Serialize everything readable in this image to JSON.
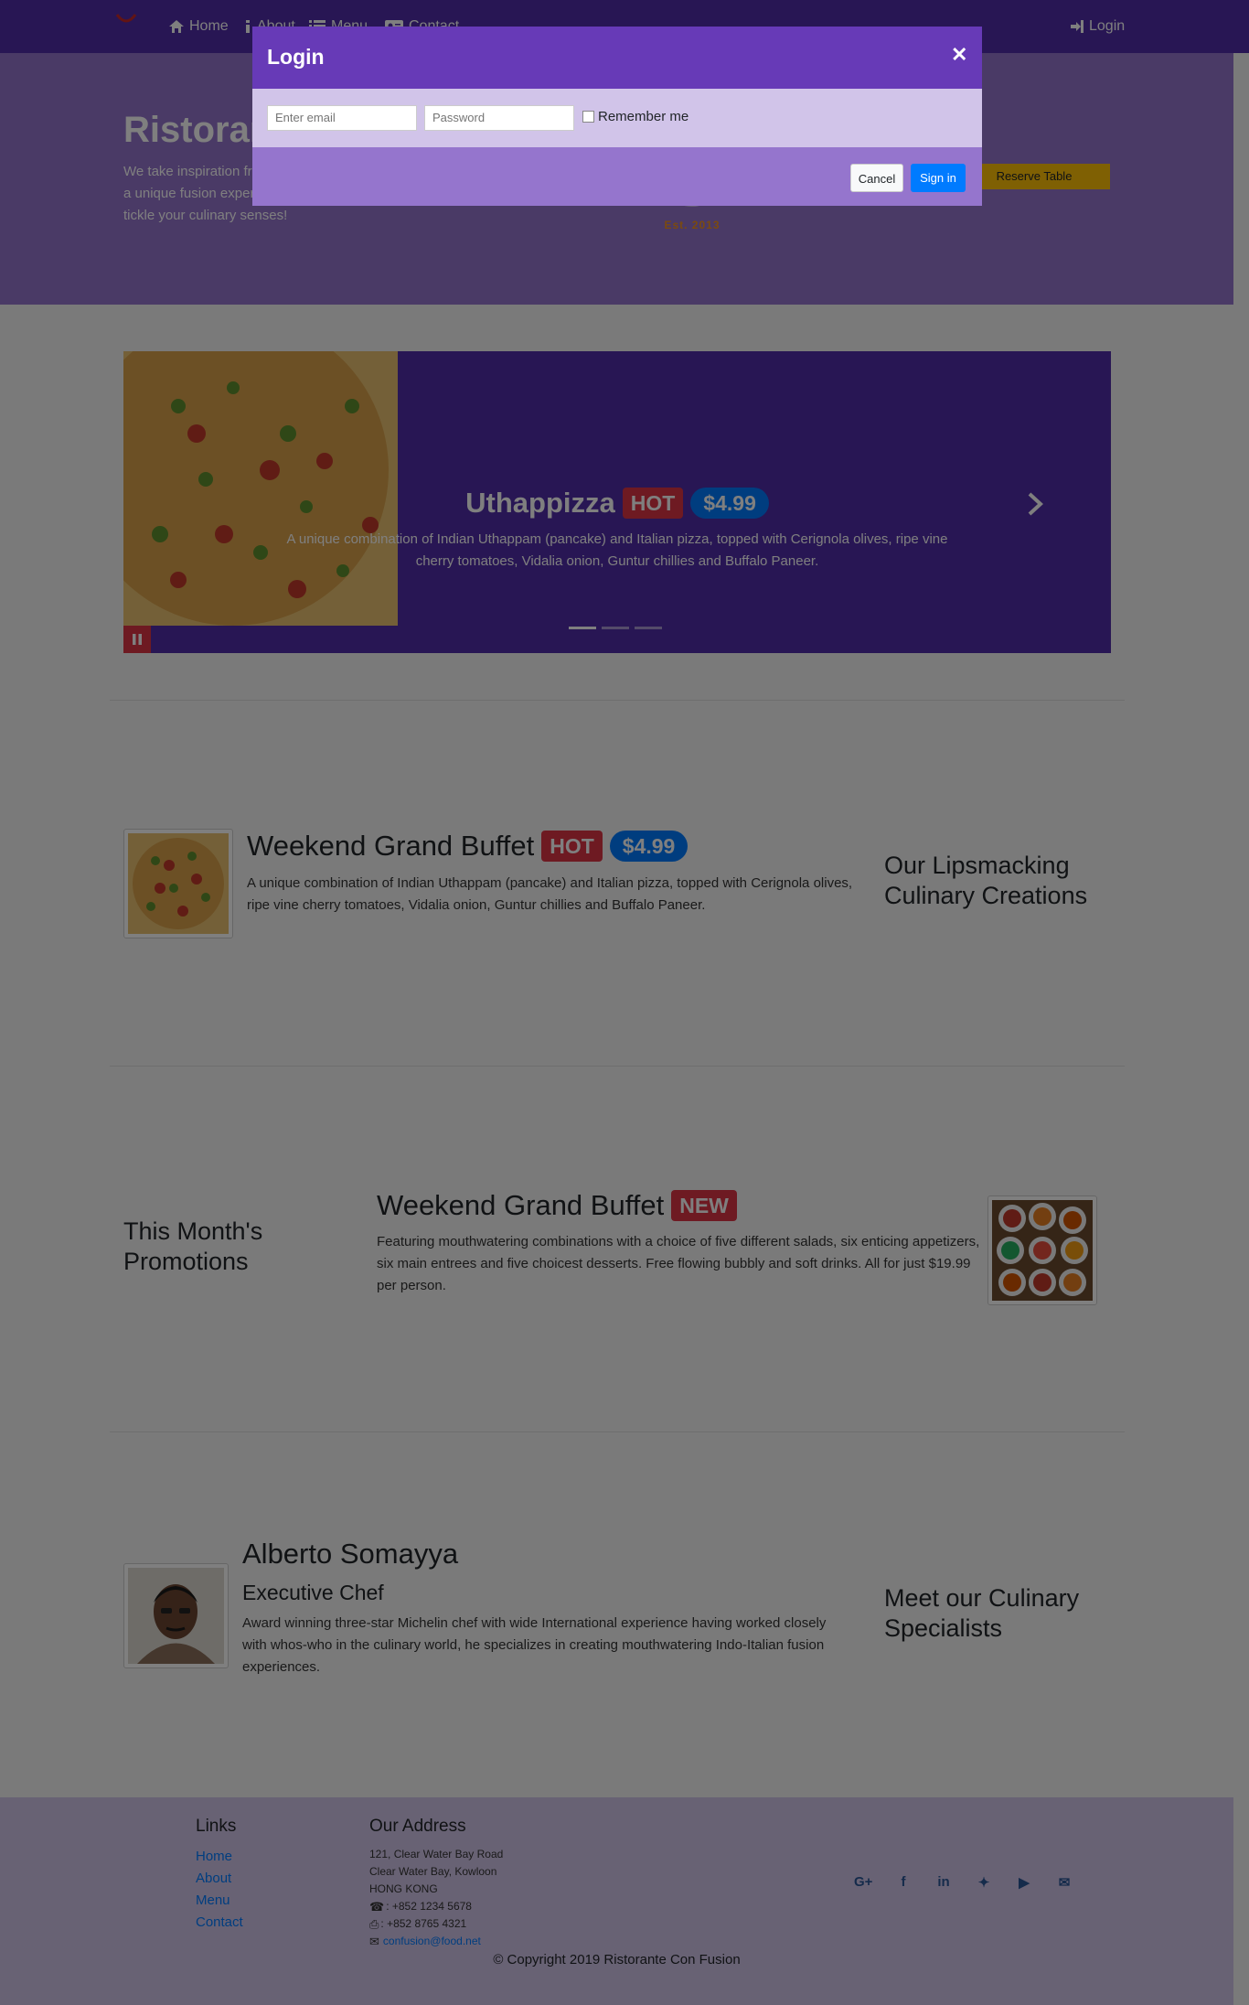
{
  "nav": {
    "items": [
      {
        "label": "Home",
        "icon": "home-icon"
      },
      {
        "label": "About",
        "icon": "info-icon"
      },
      {
        "label": "Menu",
        "icon": "list-icon"
      },
      {
        "label": "Contact",
        "icon": "address-card-icon"
      }
    ],
    "login_label": "Login"
  },
  "jumbotron": {
    "title": "Ristorante Con Fusion",
    "text": "We take inspiration from the World's best cuisines, and create a unique fusion experience. Our lipsmacking creations will tickle your culinary senses!",
    "logo_text": "Est. 2013",
    "reserve_label": "Reserve Table"
  },
  "carousel": {
    "title": "Uthappizza",
    "badge": "HOT",
    "price": "$4.99",
    "description": "A unique combination of Indian Uthappam (pancake) and Italian pizza, topped with Cerignola olives, ripe vine cherry tomatoes, Vidalia onion, Guntur chillies and Buffalo Paneer.",
    "slides": 3,
    "active_slide": 0
  },
  "dish": {
    "title": "Weekend Grand Buffet",
    "badge": "HOT",
    "price": "$4.99",
    "description": "A unique combination of Indian Uthappam (pancake) and Italian pizza, topped with Cerignola olives, ripe vine cherry tomatoes, Vidalia onion, Guntur chillies and Buffalo Paneer.",
    "side_heading": "Our Lipsmacking Culinary Creations"
  },
  "promotion": {
    "side_heading": "This Month's Promotions",
    "title": "Weekend Grand Buffet",
    "badge": "NEW",
    "description": "Featuring mouthwatering combinations with a choice of five different salads, six enticing appetizers, six main entrees and five choicest desserts. Free flowing bubbly and soft drinks. All for just $19.99 per person."
  },
  "leader": {
    "name": "Alberto Somayya",
    "role": "Executive Chef",
    "description": "Award winning three-star Michelin chef with wide International experience having worked closely with whos-who in the culinary world, he specializes in creating mouthwatering Indo-Italian fusion experiences.",
    "side_heading": "Meet our Culinary Specialists"
  },
  "footer": {
    "links_heading": "Links",
    "links": [
      "Home",
      "About",
      "Menu",
      "Contact"
    ],
    "address_heading": "Our Address",
    "address": [
      "121, Clear Water Bay Road",
      "Clear Water Bay, Kowloon",
      "HONG KONG"
    ],
    "phone": ": +852 1234 5678",
    "fax": ": +852 8765 4321",
    "email": "confusion@food.net",
    "social": [
      "G+",
      "f",
      "in",
      "t",
      "yt",
      "mail"
    ],
    "copyright": "© Copyright 2019 Ristorante Con Fusion"
  },
  "modal": {
    "title": "Login",
    "email_placeholder": "Enter email",
    "password_placeholder": "Password",
    "remember_label": "Remember me",
    "cancel_label": "Cancel",
    "signin_label": "Sign in"
  },
  "colors": {
    "primary": "#512da8",
    "primary_light": "#9575cd",
    "primary_lighter": "#d1c4e9",
    "modal_header": "#673ab7",
    "danger": "#dc3545",
    "info": "#007bff",
    "warning": "#ffc107"
  }
}
